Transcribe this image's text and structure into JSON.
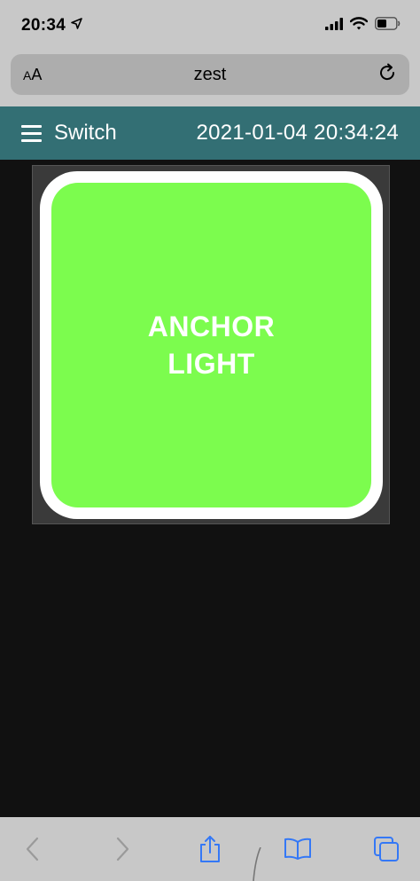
{
  "status_bar": {
    "time": "20:34",
    "location_icon": "location-arrow-icon",
    "signal_icon": "cellular-signal-icon",
    "wifi_icon": "wifi-icon",
    "battery_icon": "battery-icon"
  },
  "browser": {
    "text_size_small": "A",
    "text_size_large": "A",
    "url": "zest"
  },
  "header": {
    "title": "Switch",
    "datetime": "2021-01-04 20:34:24"
  },
  "switch": {
    "label_line1": "ANCHOR",
    "label_line2": "LIGHT",
    "color": "#7cfc4e"
  },
  "colors": {
    "header_bg": "#336f74",
    "page_bg": "#111111",
    "toolbar_icon": "#3478f6"
  }
}
